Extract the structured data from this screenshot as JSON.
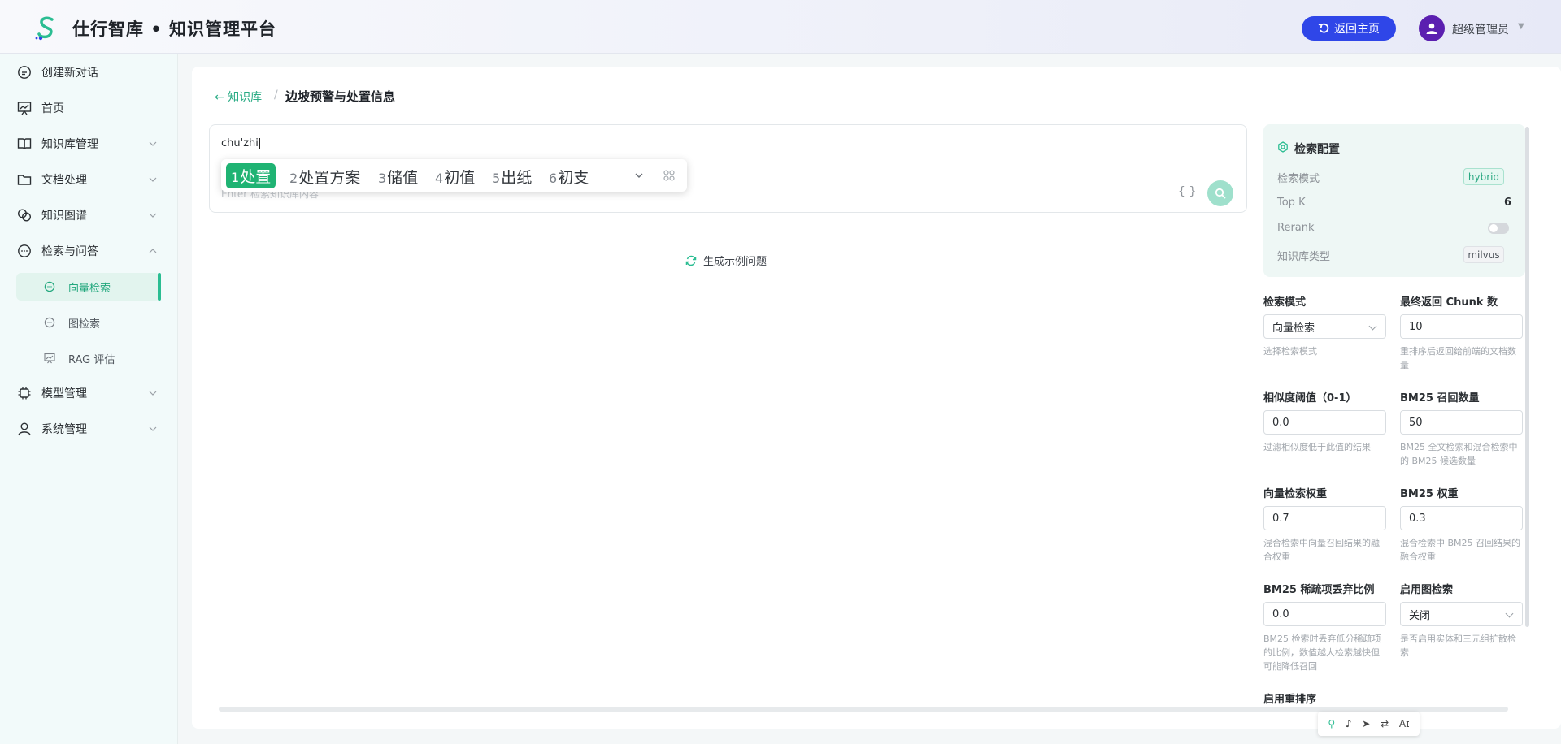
{
  "header": {
    "title": "仕行智库 • 知识管理平台",
    "home_button": "返回主页",
    "user_name": "超级管理员"
  },
  "sidebar": {
    "items": [
      {
        "label": "创建新对话",
        "icon": "chat-plus-icon"
      },
      {
        "label": "首页",
        "icon": "chart-icon"
      },
      {
        "label": "知识库管理",
        "icon": "book-icon"
      },
      {
        "label": "文档处理",
        "icon": "folder-icon"
      },
      {
        "label": "知识图谱",
        "icon": "graph-icon"
      },
      {
        "label": "检索与问答",
        "icon": "chat-icon"
      },
      {
        "label": "模型管理",
        "icon": "chip-icon"
      },
      {
        "label": "系统管理",
        "icon": "user-icon"
      }
    ],
    "subitems": [
      {
        "label": "向量检索",
        "icon": "chat-bubble-icon",
        "active": true
      },
      {
        "label": "图检索",
        "icon": "chat-bubble-icon"
      },
      {
        "label": "RAG 评估",
        "icon": "chart-icon"
      }
    ]
  },
  "breadcrumb": {
    "back": "知识库",
    "separator": "/",
    "current": "边坡预警与处置信息"
  },
  "query": {
    "value": "chu'zhi",
    "placeholder": "Enter 检索知识库内容",
    "brace_label": "{ }"
  },
  "ime": {
    "candidates": [
      {
        "n": "1",
        "text": "处置",
        "selected": true
      },
      {
        "n": "2",
        "text": "处置方案"
      },
      {
        "n": "3",
        "text": "储值"
      },
      {
        "n": "4",
        "text": "初值"
      },
      {
        "n": "5",
        "text": "出纸"
      },
      {
        "n": "6",
        "text": "初支"
      }
    ]
  },
  "generate_example": "生成示例问题",
  "config": {
    "title": "检索配置",
    "mode_label": "检索模式",
    "mode_value": "hybrid",
    "topk_label": "Top K",
    "topk_value": "6",
    "rerank_label": "Rerank",
    "rerank_on": false,
    "kb_type_label": "知识库类型",
    "kb_type_value": "milvus"
  },
  "form": {
    "search_mode": {
      "label": "检索模式",
      "value": "向量检索",
      "help": "选择检索模式"
    },
    "final_chunks": {
      "label": "最终返回 Chunk 数",
      "value": "10",
      "help": "重排序后返回给前端的文档数量"
    },
    "similarity": {
      "label": "相似度阈值（0-1）",
      "value": "0.0",
      "help": "过滤相似度低于此值的结果"
    },
    "bm25_recall": {
      "label": "BM25 召回数量",
      "value": "50",
      "help": "BM25 全文检索和混合检索中的 BM25 候选数量"
    },
    "vector_weight": {
      "label": "向量检索权重",
      "value": "0.7",
      "help": "混合检索中向量召回结果的融合权重"
    },
    "bm25_weight": {
      "label": "BM25 权重",
      "value": "0.3",
      "help": "混合检索中 BM25 召回结果的融合权重"
    },
    "bm25_drop": {
      "label": "BM25 稀疏项丢弃比例",
      "value": "0.0",
      "help": "BM25 检索时丢弃低分稀疏项的比例，数值越大检索越快但可能降低召回"
    },
    "graph_search": {
      "label": "启用图检索",
      "value": "关闭",
      "help": "是否启用实体和三元组扩散检索"
    },
    "rerank": {
      "label": "启用重排序"
    }
  },
  "colors": {
    "accent": "#2bbd92",
    "primary_button": "#2f46e8",
    "ime_selected": "#1fb373"
  }
}
